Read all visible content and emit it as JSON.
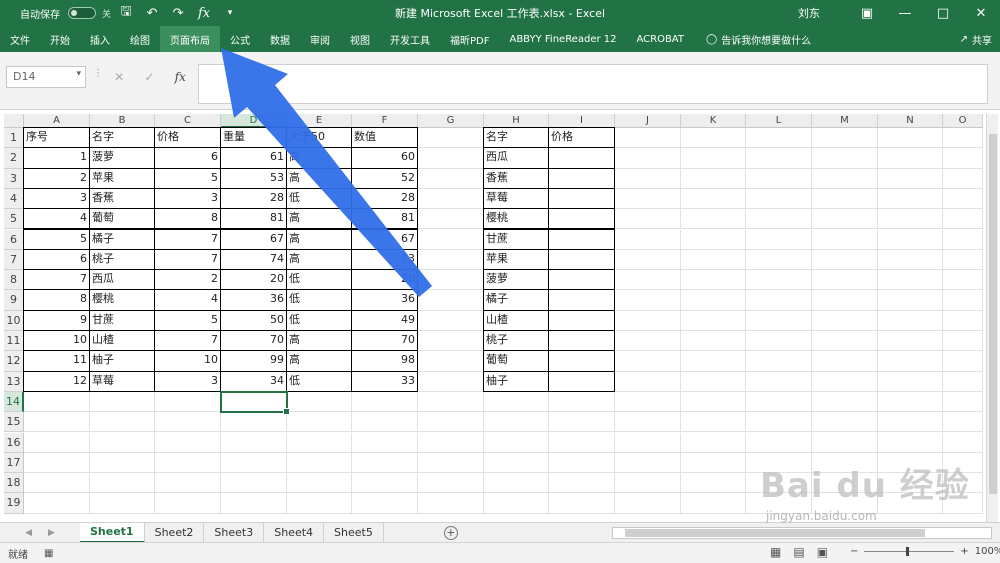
{
  "titlebar": {
    "autosave_label": "自动保存",
    "autosave_state": "关",
    "title": "新建 Microsoft Excel 工作表.xlsx  -  Excel",
    "user": "刘东"
  },
  "ribbon": {
    "tabs": [
      "文件",
      "开始",
      "插入",
      "绘图",
      "页面布局",
      "公式",
      "数据",
      "审阅",
      "视图",
      "开发工具",
      "福昕PDF",
      "ABBYY FineReader 12",
      "ACROBAT"
    ],
    "highlighted": "页面布局",
    "tell_me": "告诉我你想要做什么",
    "share": "共享"
  },
  "formula_bar": {
    "name_box": "D14",
    "formula": ""
  },
  "columns": [
    "A",
    "B",
    "C",
    "D",
    "E",
    "F",
    "G",
    "H",
    "I",
    "J",
    "K",
    "L",
    "M",
    "N",
    "O"
  ],
  "selected_column": "D",
  "rows": [
    "1",
    "2",
    "3",
    "4",
    "5",
    "6",
    "7",
    "8",
    "9",
    "10",
    "11",
    "12",
    "13",
    "14",
    "15",
    "16",
    "17",
    "18",
    "19"
  ],
  "selected_row": "14",
  "table1": {
    "header": [
      "序号",
      "名字",
      "价格",
      "重量",
      "大于50",
      "数值"
    ],
    "rows": [
      [
        "1",
        "菠萝",
        "6",
        "61",
        "高",
        "60"
      ],
      [
        "2",
        "苹果",
        "5",
        "53",
        "高",
        "52"
      ],
      [
        "3",
        "香蕉",
        "3",
        "28",
        "低",
        "28"
      ],
      [
        "4",
        "葡萄",
        "8",
        "81",
        "高",
        "81"
      ],
      [
        "5",
        "橘子",
        "7",
        "67",
        "高",
        "67"
      ],
      [
        "6",
        "桃子",
        "7",
        "74",
        "高",
        "73"
      ],
      [
        "7",
        "西瓜",
        "2",
        "20",
        "低",
        "20"
      ],
      [
        "8",
        "樱桃",
        "4",
        "36",
        "低",
        "36"
      ],
      [
        "9",
        "甘蔗",
        "5",
        "50",
        "低",
        "49"
      ],
      [
        "10",
        "山楂",
        "7",
        "70",
        "高",
        "70"
      ],
      [
        "11",
        "柚子",
        "10",
        "99",
        "高",
        "98"
      ],
      [
        "12",
        "草莓",
        "3",
        "34",
        "低",
        "33"
      ]
    ]
  },
  "table2": {
    "header": [
      "名字",
      "价格"
    ],
    "rows": [
      [
        "西瓜",
        ""
      ],
      [
        "香蕉",
        ""
      ],
      [
        "草莓",
        ""
      ],
      [
        "樱桃",
        ""
      ],
      [
        "甘蔗",
        ""
      ],
      [
        "苹果",
        ""
      ],
      [
        "菠萝",
        ""
      ],
      [
        "橘子",
        ""
      ],
      [
        "山楂",
        ""
      ],
      [
        "桃子",
        ""
      ],
      [
        "葡萄",
        ""
      ],
      [
        "柚子",
        ""
      ]
    ]
  },
  "sheets": [
    "Sheet1",
    "Sheet2",
    "Sheet3",
    "Sheet4",
    "Sheet5"
  ],
  "active_sheet": "Sheet1",
  "status": {
    "ready": "就绪",
    "zoom": "100%"
  },
  "watermark": {
    "brand": "Bai du 经验",
    "url": "jingyan.baidu.com"
  },
  "colors": {
    "excel_green": "#217346",
    "arrow_blue": "#2f6ee8"
  }
}
